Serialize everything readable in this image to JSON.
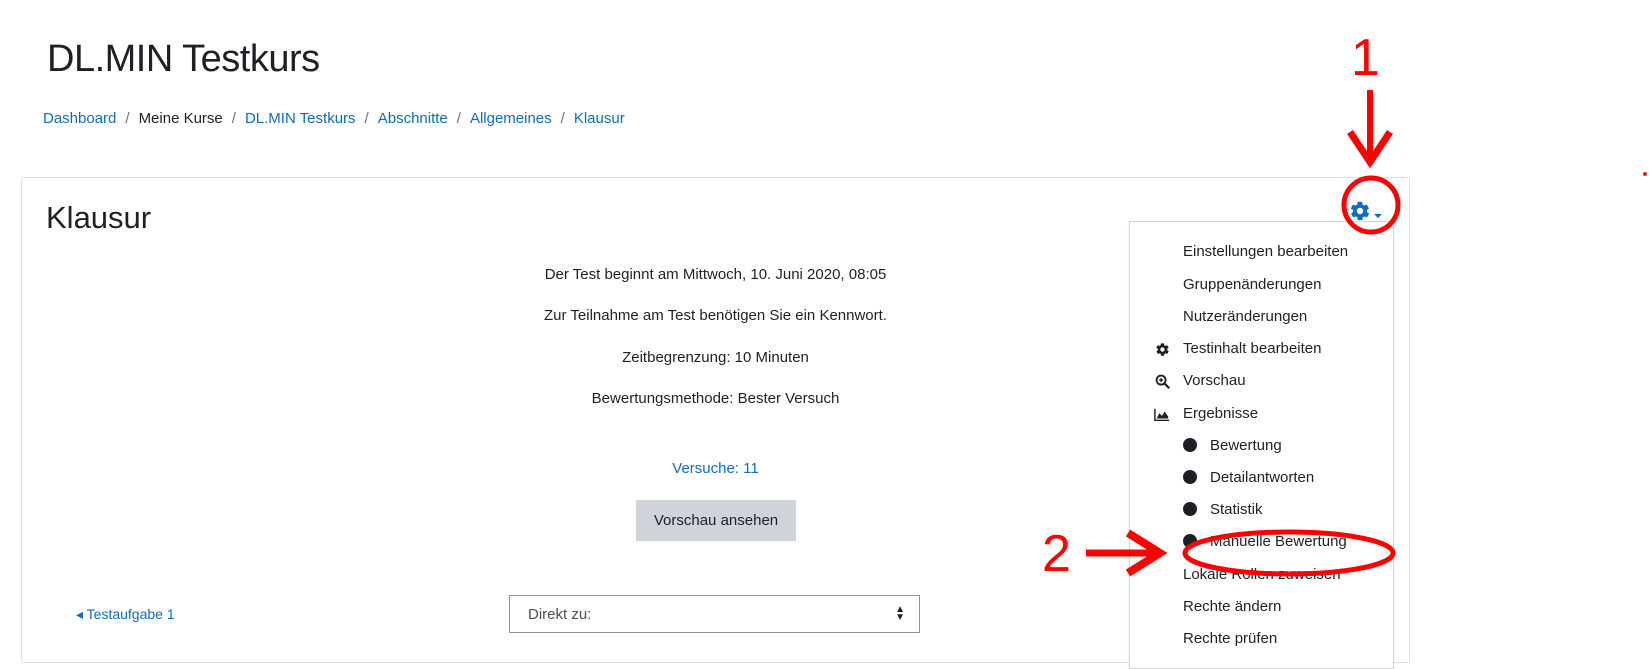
{
  "header": {
    "course_title": "DL.MIN Testkurs",
    "breadcrumb": [
      {
        "label": "Dashboard",
        "link": true
      },
      {
        "label": "Meine Kurse",
        "link": false
      },
      {
        "label": "DL.MIN Testkurs",
        "link": true
      },
      {
        "label": "Abschnitte",
        "link": true
      },
      {
        "label": "Allgemeines",
        "link": true
      },
      {
        "label": "Klausur",
        "link": true
      }
    ]
  },
  "main": {
    "page_title": "Klausur",
    "info_lines": [
      "Der Test beginnt am Mittwoch, 10. Juni 2020, 08:05",
      "Zur Teilnahme am Test benötigen Sie ein Kennwort.",
      "Zeitbegrenzung: 10 Minuten",
      "Bewertungsmethode: Bester Versuch"
    ],
    "attempts_link": "Versuche: 11",
    "preview_button": "Vorschau ansehen",
    "prev_activity": "◂ Testaufgabe 1",
    "jump_select": "Direkt zu:"
  },
  "settings_menu": {
    "items": [
      {
        "label": "Einstellungen bearbeiten",
        "icon": ""
      },
      {
        "label": "Gruppenänderungen",
        "icon": ""
      },
      {
        "label": "Nutzeränderungen",
        "icon": ""
      },
      {
        "label": "Testinhalt bearbeiten",
        "icon": "gear-icon"
      },
      {
        "label": "Vorschau",
        "icon": "magnifier-icon"
      },
      {
        "label": "Ergebnisse",
        "icon": "area-chart-icon"
      },
      {
        "label": "Bewertung",
        "icon": "bullet"
      },
      {
        "label": "Detailantworten",
        "icon": "bullet"
      },
      {
        "label": "Statistik",
        "icon": "bullet"
      },
      {
        "label": "Manuelle Bewertung",
        "icon": "bullet"
      },
      {
        "label": "Lokale Rollen zuweisen",
        "icon": ""
      },
      {
        "label": "Rechte ändern",
        "icon": ""
      },
      {
        "label": "Rechte prüfen",
        "icon": ""
      }
    ]
  },
  "annotations": {
    "step1": "1",
    "step2": "2",
    "color": "#ff0000"
  },
  "colors": {
    "link": "#0f6cbf",
    "text": "#1d2125",
    "button_bg": "#ced4da"
  }
}
